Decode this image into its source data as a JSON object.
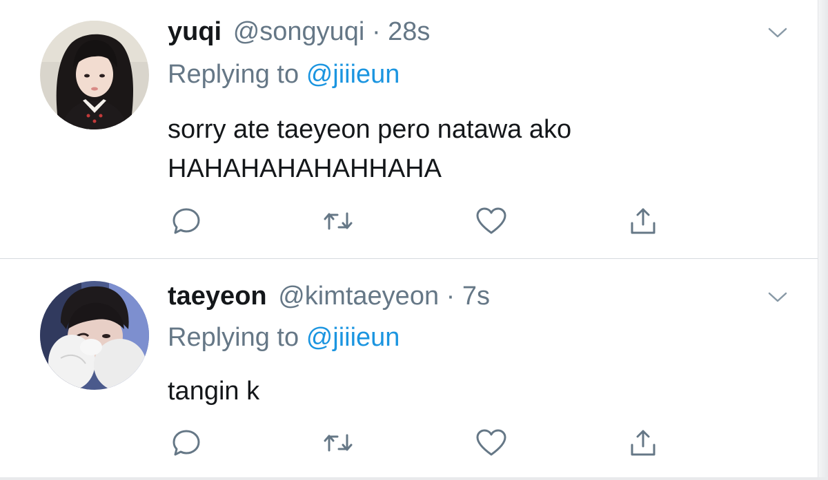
{
  "colors": {
    "name": "#14171a",
    "secondary": "#657786",
    "link": "#1b95e0",
    "icon": "#657786",
    "divider": "#d6dade"
  },
  "tweets": [
    {
      "display_name": "yuqi",
      "handle": "@songyuqi",
      "separator": "·",
      "time": "28s",
      "replying_prefix": "Replying to",
      "replying_to": "@jiiieun",
      "text": "sorry ate taeyeon pero natawa ako\nHAHAHAHAHAHHAHA",
      "icons": [
        "reply-icon",
        "retweet-icon",
        "like-icon",
        "share-icon",
        "chevron-down-icon"
      ]
    },
    {
      "display_name": "taeyeon",
      "handle": "@kimtaeyeon",
      "separator": "·",
      "time": "7s",
      "replying_prefix": "Replying to",
      "replying_to": "@jiiieun",
      "text": "tangin k",
      "icons": [
        "reply-icon",
        "retweet-icon",
        "like-icon",
        "share-icon",
        "chevron-down-icon"
      ]
    }
  ]
}
